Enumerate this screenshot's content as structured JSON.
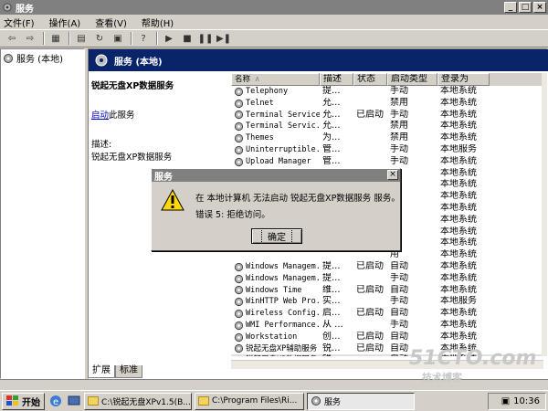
{
  "window": {
    "title": "服务"
  },
  "menu": [
    "文件(F)",
    "操作(A)",
    "查看(V)",
    "帮助(H)"
  ],
  "toolbar": {
    "icons": [
      "back-icon",
      "forward-icon",
      "show-tree-icon",
      "properties-icon",
      "refresh-icon",
      "export-icon",
      "help-icon",
      "play-icon",
      "stop-icon",
      "pause-icon",
      "restart-icon"
    ]
  },
  "tree": {
    "root_label": "服务 (本地)"
  },
  "banner": {
    "title": "服务 (本地)"
  },
  "desc": {
    "service_name": "锐起无盘XP数据服务",
    "start_link": "启动",
    "start_suffix": "此服务",
    "desc_label": "描述:",
    "desc_text": "锐起无盘XP数据服务"
  },
  "services": {
    "headers": [
      "名称",
      "描述",
      "状态",
      "启动类型",
      "登录为"
    ],
    "rows": [
      [
        "Telephony",
        "提...",
        "",
        "手动",
        "本地系统"
      ],
      [
        "Telnet",
        "允...",
        "",
        "禁用",
        "本地系统"
      ],
      [
        "Terminal Services",
        "允...",
        "已启动",
        "手动",
        "本地系统"
      ],
      [
        "Terminal Servic...",
        "允...",
        "",
        "禁用",
        "本地系统"
      ],
      [
        "Themes",
        "为...",
        "",
        "禁用",
        "本地系统"
      ],
      [
        "Uninterruptible...",
        "管...",
        "",
        "手动",
        "本地服务"
      ],
      [
        "Upload Manager",
        "管...",
        "",
        "手动",
        "本地系统"
      ],
      [
        "",
        "",
        "",
        "",
        "本地系统"
      ],
      [
        "",
        "",
        "",
        "",
        "本地系统"
      ],
      [
        "",
        "",
        "",
        "用",
        "本地系统"
      ],
      [
        "",
        "",
        "",
        "用",
        "本地系统"
      ],
      [
        "",
        "",
        "",
        "用",
        "本地系统"
      ],
      [
        "",
        "",
        "",
        "用",
        "本地系统"
      ],
      [
        "",
        "",
        "",
        "用",
        "本地系统"
      ],
      [
        "",
        "",
        "",
        "用",
        "本地系统"
      ],
      [
        "Windows Managem...",
        "提...",
        "已启动",
        "自动",
        "本地系统"
      ],
      [
        "Windows Managem...",
        "提...",
        "",
        "手动",
        "本地系统"
      ],
      [
        "Windows Time",
        "维...",
        "已启动",
        "自动",
        "本地系统"
      ],
      [
        "WinHTTP Web Pro...",
        "实...",
        "",
        "手动",
        "本地服务"
      ],
      [
        "Wireless Config...",
        "启...",
        "已启动",
        "自动",
        "本地系统"
      ],
      [
        "WMI Performance...",
        "从 ...",
        "",
        "手动",
        "本地系统"
      ],
      [
        "Workstation",
        "创...",
        "已启动",
        "自动",
        "本地系统"
      ],
      [
        "锐起无盘XP辅助服务",
        "锐...",
        "已启动",
        "自动",
        "本地系统"
      ],
      [
        "锐起无盘XP数据服务",
        "锐...",
        "",
        "自动",
        "本地系统"
      ]
    ]
  },
  "tabs": [
    "扩展",
    "标准"
  ],
  "dialog": {
    "title": "服务",
    "message": "在 本地计算机 无法启动 锐起无盘XP数据服务 服务。",
    "error": "错误 5: 拒绝访问。",
    "ok_label": "确定"
  },
  "taskbar": {
    "start_label": "开始",
    "tasks": [
      "C:\\锐起无盘XPv1.5(B...",
      "C:\\Program Files\\Ri...",
      "服务"
    ],
    "clock": "10:36"
  },
  "watermark": {
    "line1": "51CTO.com",
    "line2": "技术博客"
  },
  "colors": {
    "banner": "#0a246a",
    "titlebar_inactive": "#808080",
    "face": "#d4d0c8",
    "link": "#0000cc"
  }
}
